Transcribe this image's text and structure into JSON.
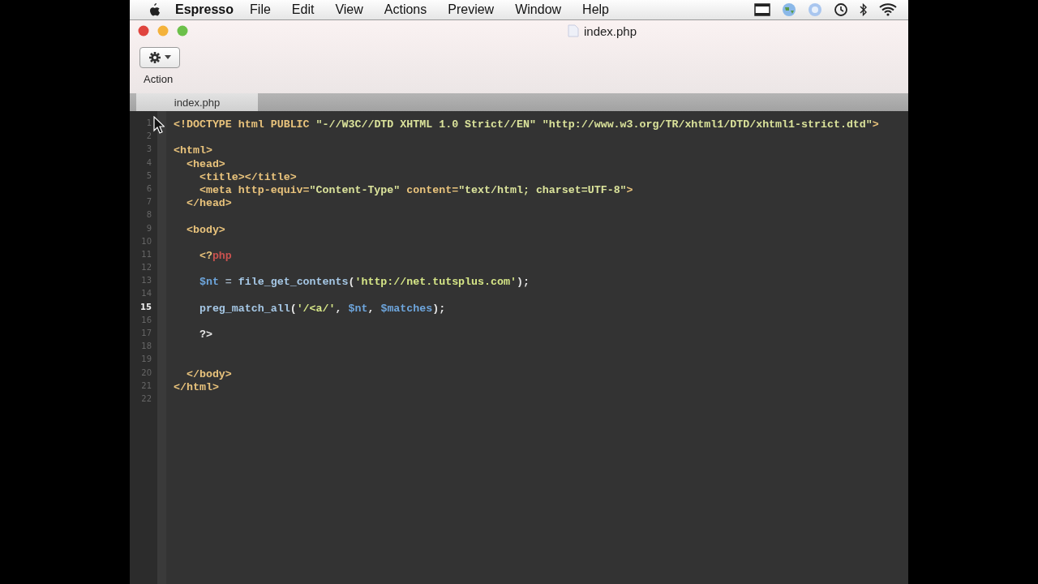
{
  "menu_bar": {
    "app_name": "Espresso",
    "items": [
      "File",
      "Edit",
      "View",
      "Actions",
      "Preview",
      "Window",
      "Help"
    ]
  },
  "window": {
    "title": "index.php",
    "toolbar": {
      "action_label": "Action"
    }
  },
  "tabs": [
    {
      "label": "index.php",
      "selected": true
    }
  ],
  "editor": {
    "lines": [
      {
        "number": "1",
        "current": false,
        "tokens": [
          {
            "kind": "tag",
            "text": "<!DOCTYPE html PUBLIC "
          },
          {
            "kind": "string",
            "text": "\"-//W3C//DTD XHTML 1.0 Strict//EN\" "
          },
          {
            "kind": "string",
            "text": "\"http://www.w3.org/TR/xhtml1/DTD/xhtml1-strict.dtd\""
          },
          {
            "kind": "tag",
            "text": ">"
          }
        ]
      },
      {
        "number": "2",
        "current": false
      },
      {
        "number": "3",
        "current": false,
        "tokens": [
          {
            "kind": "tag",
            "text": "<html>"
          }
        ]
      },
      {
        "number": "4",
        "current": false,
        "tokens": [
          {
            "kind": "tag",
            "text": "  <head>"
          }
        ]
      },
      {
        "number": "5",
        "current": false,
        "tokens": [
          {
            "kind": "tag",
            "text": "    <title></title>"
          }
        ]
      },
      {
        "number": "6",
        "current": false,
        "tokens": [
          {
            "kind": "tag",
            "text": "    <meta http-equiv="
          },
          {
            "kind": "string",
            "text": "\"Content-Type\""
          },
          {
            "kind": "tag",
            "text": " content="
          },
          {
            "kind": "string",
            "text": "\"text/html; charset=UTF-8\""
          },
          {
            "kind": "tag",
            "text": ">"
          }
        ]
      },
      {
        "number": "7",
        "current": false,
        "tokens": [
          {
            "kind": "tag",
            "text": "  </head>"
          }
        ]
      },
      {
        "number": "8",
        "current": false
      },
      {
        "number": "9",
        "current": false,
        "tokens": [
          {
            "kind": "tag",
            "text": "  <body>"
          }
        ]
      },
      {
        "number": "10",
        "current": false
      },
      {
        "number": "11",
        "current": false,
        "tokens": [
          {
            "kind": "tag",
            "text": "    <?"
          },
          {
            "kind": "keyword",
            "text": "php"
          }
        ]
      },
      {
        "number": "12",
        "current": false
      },
      {
        "number": "13",
        "current": false,
        "tokens": [
          {
            "kind": "variable",
            "text": "    $nt"
          },
          {
            "kind": "operator",
            "text": " = "
          },
          {
            "kind": "function",
            "text": "file_get_contents"
          },
          {
            "kind": "punct",
            "text": "("
          },
          {
            "kind": "phpstring",
            "text": "'http://net.tutsplus.com'"
          },
          {
            "kind": "punct",
            "text": ");"
          }
        ]
      },
      {
        "number": "14",
        "current": false
      },
      {
        "number": "15",
        "current": true,
        "tokens": [
          {
            "kind": "function",
            "text": "    preg_match_all"
          },
          {
            "kind": "punct",
            "text": "("
          },
          {
            "kind": "phpstring",
            "text": "'/<a/'"
          },
          {
            "kind": "punct",
            "text": ", "
          },
          {
            "kind": "variable",
            "text": "$nt"
          },
          {
            "kind": "punct",
            "text": ", "
          },
          {
            "kind": "variable",
            "text": "$matches"
          },
          {
            "kind": "punct",
            "text": ");"
          }
        ]
      },
      {
        "number": "16",
        "current": false
      },
      {
        "number": "17",
        "current": false,
        "tokens": [
          {
            "kind": "punct",
            "text": "    ?>"
          }
        ]
      },
      {
        "number": "18",
        "current": false
      },
      {
        "number": "19",
        "current": false
      },
      {
        "number": "20",
        "current": false,
        "tokens": [
          {
            "kind": "tag",
            "text": "  </body>"
          }
        ]
      },
      {
        "number": "21",
        "current": false,
        "tokens": [
          {
            "kind": "tag",
            "text": "</html>"
          }
        ]
      },
      {
        "number": "22",
        "current": false
      }
    ]
  }
}
